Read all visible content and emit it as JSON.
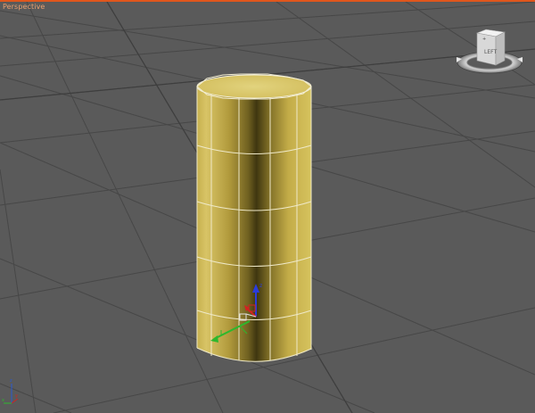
{
  "viewport": {
    "label": "Perspective",
    "background": "#5a5a5a",
    "border_color": "#e0561c",
    "grid_color": "#464646"
  },
  "object": {
    "type": "cylinder",
    "color": "#d4c261",
    "edge_color": "#f4f0d6"
  },
  "viewcube": {
    "face_label": "LEFT",
    "face_color": "#d8d8d8"
  },
  "gizmo": {
    "x_color": "#2db82d",
    "y_color": "#d22222",
    "z_color": "#2a3cdc"
  },
  "axis_tripod": {
    "icon": "world-axis-icon"
  }
}
